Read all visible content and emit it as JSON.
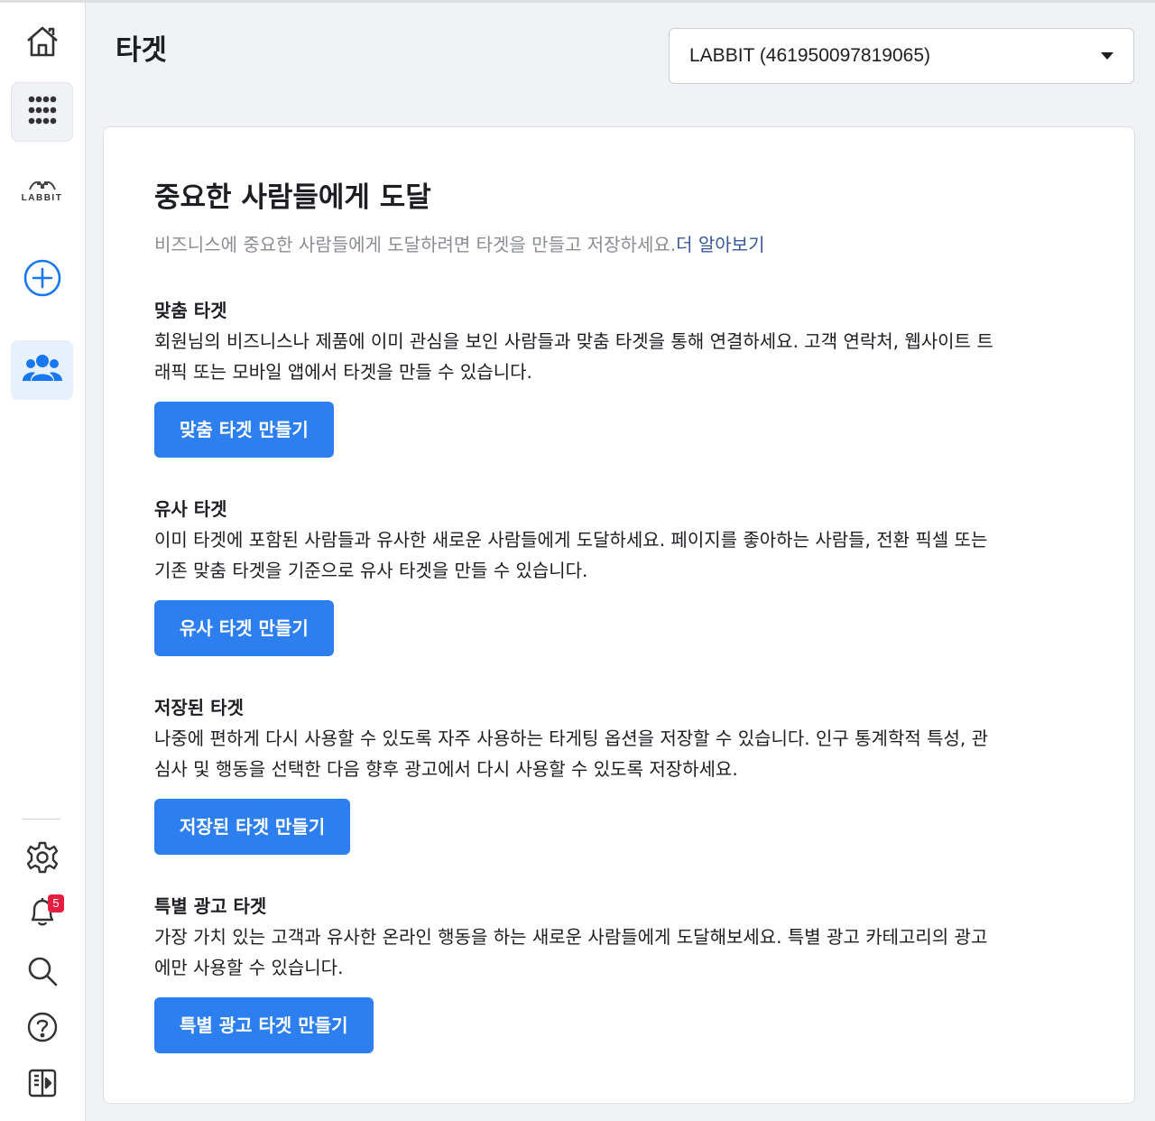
{
  "sidebar": {
    "logo_text": "LABBIT",
    "notifications_count": "5",
    "icons": [
      "home-icon",
      "apps-grid-icon",
      "plus-circle-icon",
      "audience-icon",
      "gear-icon",
      "bell-icon",
      "search-icon",
      "help-icon",
      "panel-toggle-icon"
    ],
    "active_color": "#1877f2"
  },
  "header": {
    "title": "타겟",
    "account_selector": "LABBIT (461950097819065)"
  },
  "main": {
    "title": "중요한 사람들에게 도달",
    "subtitle": "비즈니스에 중요한 사람들에게 도달하려면 타겟을 만들고 저장하세요.",
    "learn_more": "더 알아보기",
    "sections": [
      {
        "heading": "맞춤 타겟",
        "line1": "회원님의 비즈니스나 제품에 이미 관심을 보인 사람들과 맞춤 타겟을 통해 연결하세요. 고객 연락처, 웹사이트 트",
        "line2": "래픽 또는 모바일 앱에서 타겟을 만들 수 있습니다.",
        "button": "맞춤 타겟 만들기"
      },
      {
        "heading": "유사 타겟",
        "line1": "이미 타겟에 포함된 사람들과 유사한 새로운 사람들에게 도달하세요. 페이지를 좋아하는 사람들, 전환 픽셀 또는",
        "line2": "기존 맞춤 타겟을 기준으로 유사 타겟을 만들 수 있습니다.",
        "button": "유사 타겟 만들기"
      },
      {
        "heading": "저장된 타겟",
        "line1": "나중에 편하게 다시 사용할 수 있도록 자주 사용하는 타게팅 옵션을 저장할 수 있습니다. 인구 통계학적 특성, 관",
        "line2": "심사 및 행동을 선택한 다음 향후 광고에서 다시 사용할 수 있도록 저장하세요.",
        "button": "저장된 타겟 만들기"
      },
      {
        "heading": "특별 광고 타겟",
        "line1": "가장 가치 있는 고객과 유사한 온라인 행동을 하는 새로운 사람들에게 도달해보세요. 특별 광고 카테고리의 광고",
        "line2": "에만 사용할 수 있습니다.",
        "button": "특별 광고 타겟 만들기"
      }
    ]
  },
  "colors": {
    "primary_button": "#2d7ff0",
    "link": "#385898",
    "badge": "#e41e3f",
    "background": "#f0f2f5"
  }
}
